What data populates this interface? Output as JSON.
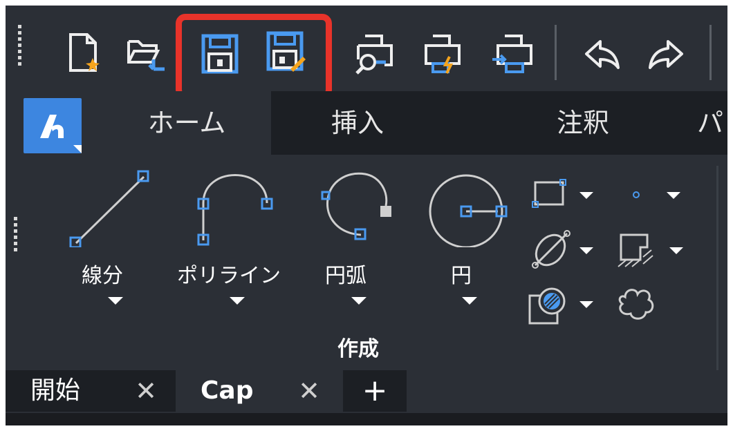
{
  "quick_access": {
    "items": [
      {
        "name": "new-file-icon"
      },
      {
        "name": "open-file-icon"
      },
      {
        "name": "save-icon"
      },
      {
        "name": "save-as-icon"
      },
      {
        "name": "print-preview-icon"
      },
      {
        "name": "publish-icon"
      },
      {
        "name": "plot-icon"
      },
      {
        "name": "undo-icon"
      },
      {
        "name": "redo-icon"
      }
    ],
    "highlight_color": "#e8332a"
  },
  "ribbon": {
    "tabs": [
      "ホーム",
      "挿入",
      "注釈",
      "パ"
    ],
    "active_tab": "ホーム",
    "app_button_accent": "#3d86e0",
    "tools": {
      "line": "線分",
      "polyline": "ポリライン",
      "arc": "円弧",
      "circle": "円"
    },
    "small_tools": [
      "rectangle-icon",
      "point-icon",
      "ellipse-icon",
      "region-icon",
      "hatch-icon",
      "revision-cloud-icon"
    ],
    "group_title": "作成"
  },
  "document_tabs": {
    "tabs": [
      "開始",
      "Cap"
    ],
    "active": "Cap",
    "close_symbol": "✕",
    "add_symbol": "+"
  },
  "colors": {
    "background": "#2b2f36",
    "accent_blue": "#3d86e0",
    "icon_fg": "#e6e6e6"
  }
}
